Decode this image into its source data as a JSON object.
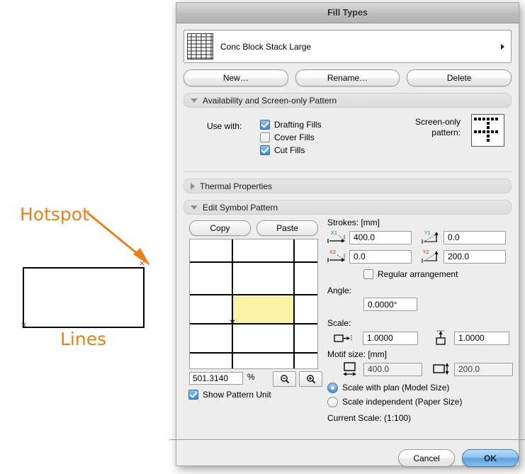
{
  "window": {
    "title": "Fill Types"
  },
  "annotations": {
    "hotspot_label": "Hotspot",
    "lines_label": "Lines",
    "hotspot_marker": "×",
    "corner_marker": "×",
    "accent_color": "#E8801A",
    "hotspot_marker_color": "#D42A2A"
  },
  "selector": {
    "value": "Conc Block Stack Large",
    "swatch_icon": "brick-stack-pattern-icon",
    "arrow_icon": "chevron-right-icon"
  },
  "top_buttons": {
    "new": "New…",
    "rename": "Rename…",
    "delete": "Delete"
  },
  "sections": {
    "availability": {
      "title": "Availability and Screen-only Pattern",
      "expanded": true,
      "use_with_label": "Use with:",
      "checkboxes": [
        {
          "label": "Drafting Fills",
          "checked": true
        },
        {
          "label": "Cover Fills",
          "checked": false
        },
        {
          "label": "Cut Fills",
          "checked": true
        }
      ],
      "screen_only_label_line1": "Screen-only",
      "screen_only_label_line2": "pattern:",
      "screen_only_swatch_icon": "cross-dot-pattern-icon"
    },
    "thermal": {
      "title": "Thermal Properties",
      "expanded": false
    },
    "edit_symbol": {
      "title": "Edit Symbol Pattern",
      "expanded": true
    }
  },
  "editor": {
    "copy_label": "Copy",
    "paste_label": "Paste",
    "zoom_value": "501.3140",
    "percent_sign": "%",
    "zoom_out_icon": "magnifier-minus-icon",
    "zoom_in_icon": "magnifier-plus-icon",
    "show_pattern_unit": {
      "label": "Show Pattern Unit",
      "checked": true
    },
    "origin_marker": "✕",
    "highlight_color": "#FCF3A6"
  },
  "strokes": {
    "title": "Strokes: [mm]",
    "fields": [
      {
        "tag": "X1",
        "tag_color": "#2E8B3D",
        "icon": "x1-horizontal-vector-icon",
        "value": "400.0"
      },
      {
        "tag": "Y1",
        "tag_color": "#2E8B3D",
        "icon": "y1-vertical-vector-icon",
        "value": "0.0"
      },
      {
        "tag": "X2",
        "tag_color": "#C0392B",
        "icon": "x2-horizontal-vector-icon",
        "value": "0.0"
      },
      {
        "tag": "Y2",
        "tag_color": "#C0392B",
        "icon": "y2-vertical-vector-icon",
        "value": "200.0"
      }
    ],
    "regular_arrangement": {
      "label": "Regular arrangement",
      "checked": false
    }
  },
  "angle": {
    "label": "Angle:",
    "value": "0.0000°"
  },
  "scale": {
    "label": "Scale:",
    "horizontal": {
      "icon": "scale-horizontal-icon",
      "value": "1.0000"
    },
    "vertical": {
      "icon": "scale-vertical-icon",
      "value": "1.0000"
    }
  },
  "motif": {
    "label": "Motif size: [mm]",
    "width": {
      "icon": "motif-width-icon",
      "value": "400.0"
    },
    "height": {
      "icon": "motif-height-icon",
      "value": "200.0"
    }
  },
  "scale_mode": {
    "options": [
      {
        "label": "Scale with plan (Model Size)",
        "selected": true
      },
      {
        "label": "Scale independent (Paper Size)",
        "selected": false
      }
    ],
    "current_scale": "Current Scale: (1:100)"
  },
  "footer": {
    "cancel": "Cancel",
    "ok": "OK"
  }
}
